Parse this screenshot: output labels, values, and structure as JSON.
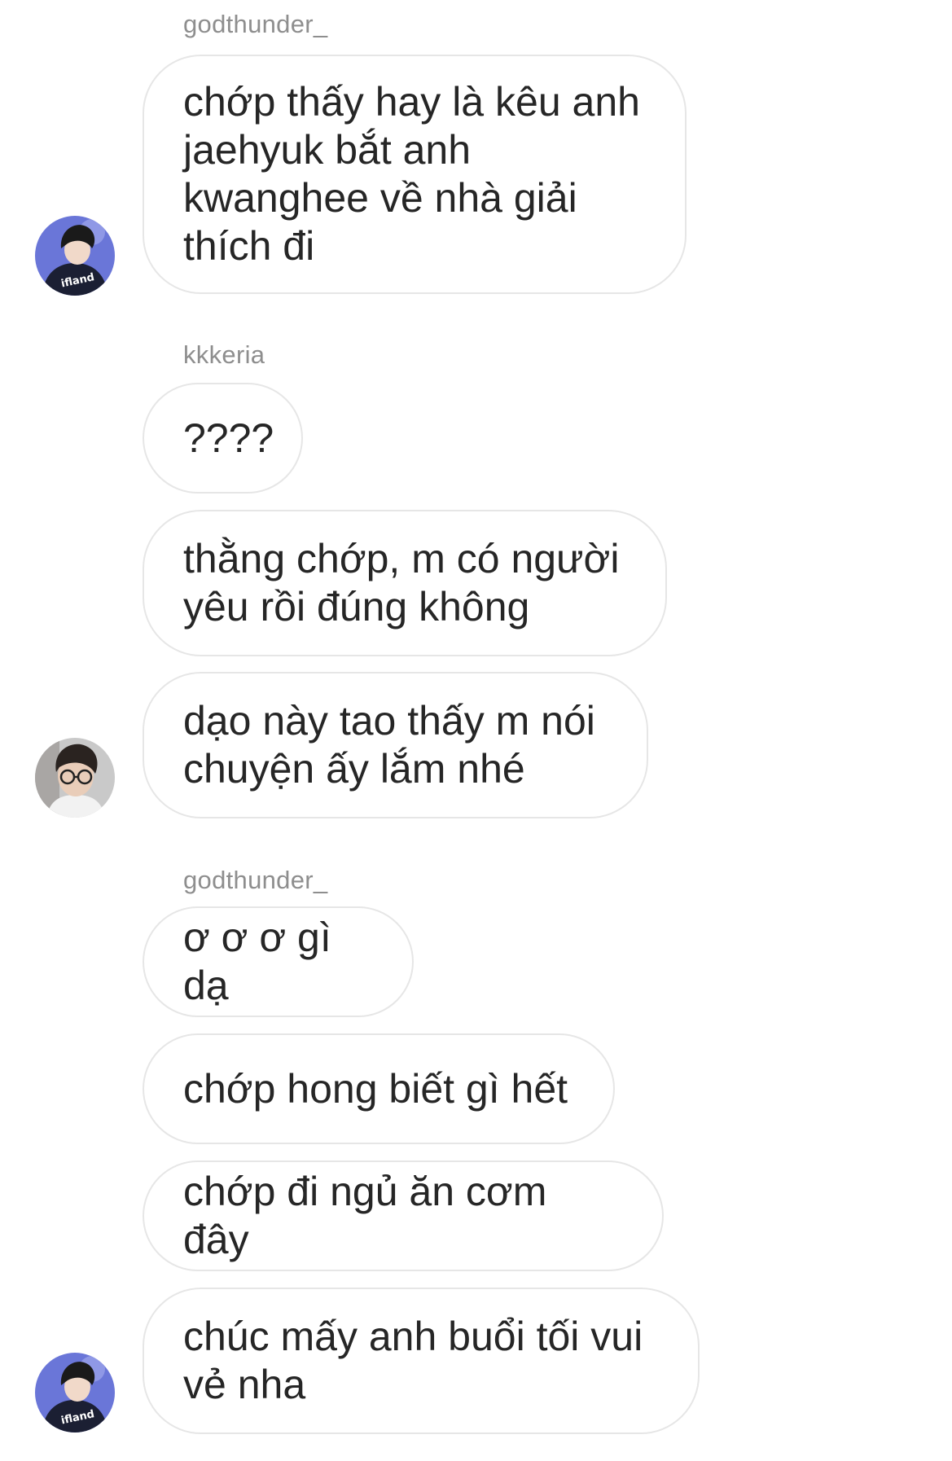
{
  "messages": [
    {
      "sender": "godthunder_",
      "bubbles": [
        "chớp thấy hay là kêu anh\njaehyuk bắt anh\nkwanghee về nhà giải\nthích đi"
      ]
    },
    {
      "sender": "kkkeria",
      "bubbles": [
        "????",
        "thằng chớp, m có người\nyêu rồi đúng không",
        "dạo này tao thấy m nói\nchuyện ấy lắm nhé"
      ]
    },
    {
      "sender": "godthunder_",
      "bubbles": [
        "ơ ơ ơ gì dạ",
        "chớp hong biết gì hết",
        "chớp đi ngủ ăn cơm đây",
        "chúc mấy anh buổi tối vui\nvẻ nha"
      ]
    }
  ],
  "avatars": {
    "godthunder": {
      "icon": "avatar-jersey-icon",
      "colors": {
        "bg": "#6a76d8",
        "jersey": "#1b1f33",
        "hair": "#1a1a1a",
        "skin": "#f1d9c9"
      }
    },
    "kkkeria": {
      "icon": "avatar-glasses-icon",
      "colors": {
        "bg": "#c9c9c9",
        "hair": "#2a2320",
        "skin": "#e9cdb9",
        "shirt": "#f2f2f2"
      }
    }
  },
  "colors": {
    "bubble_border": "#e6e6e6",
    "sender_text": "#8e8e8e",
    "message_text": "#262626"
  }
}
